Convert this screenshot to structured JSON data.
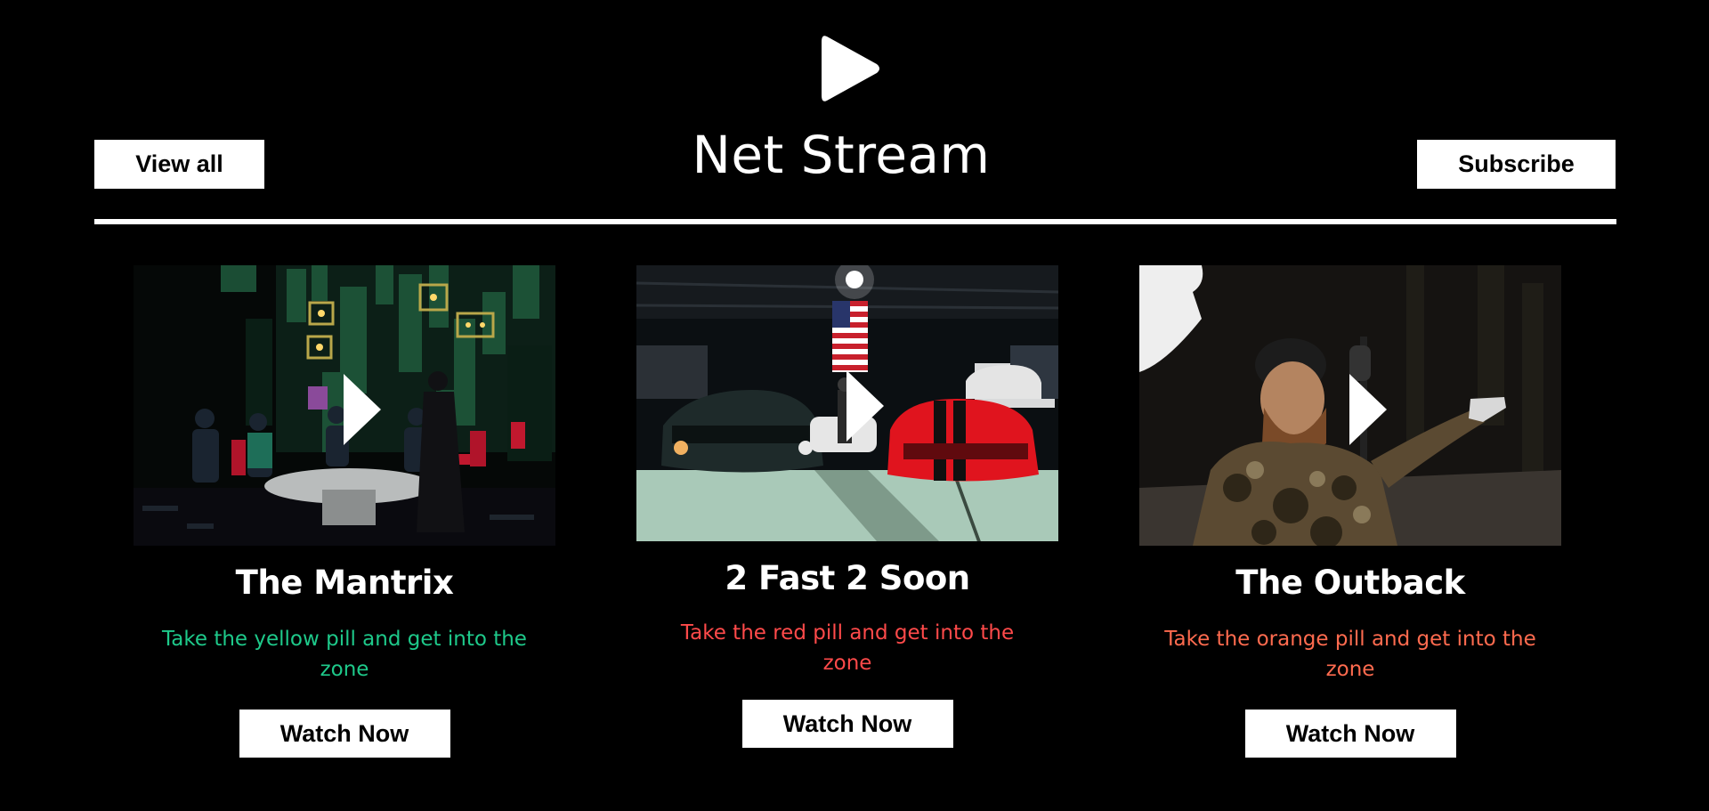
{
  "header": {
    "logo_icon": "play-icon",
    "title": "Net Stream",
    "view_all_label": "View all",
    "subscribe_label": "Subscribe"
  },
  "movies": [
    {
      "title": "The Mantrix",
      "description": "Take the yellow pill and get into the zone",
      "description_color": "#1ec98a",
      "button_label": "Watch Now",
      "thumbnail_icon": "play-icon"
    },
    {
      "title": "2 Fast 2 Soon",
      "description": "Take the red pill and get into the zone",
      "description_color": "#ff4a4a",
      "button_label": "Watch Now",
      "thumbnail_icon": "play-icon"
    },
    {
      "title": "The Outback",
      "description": "Take the orange pill and get into the zone",
      "description_color": "#ff6b4f",
      "button_label": "Watch Now",
      "thumbnail_icon": "play-icon"
    }
  ]
}
